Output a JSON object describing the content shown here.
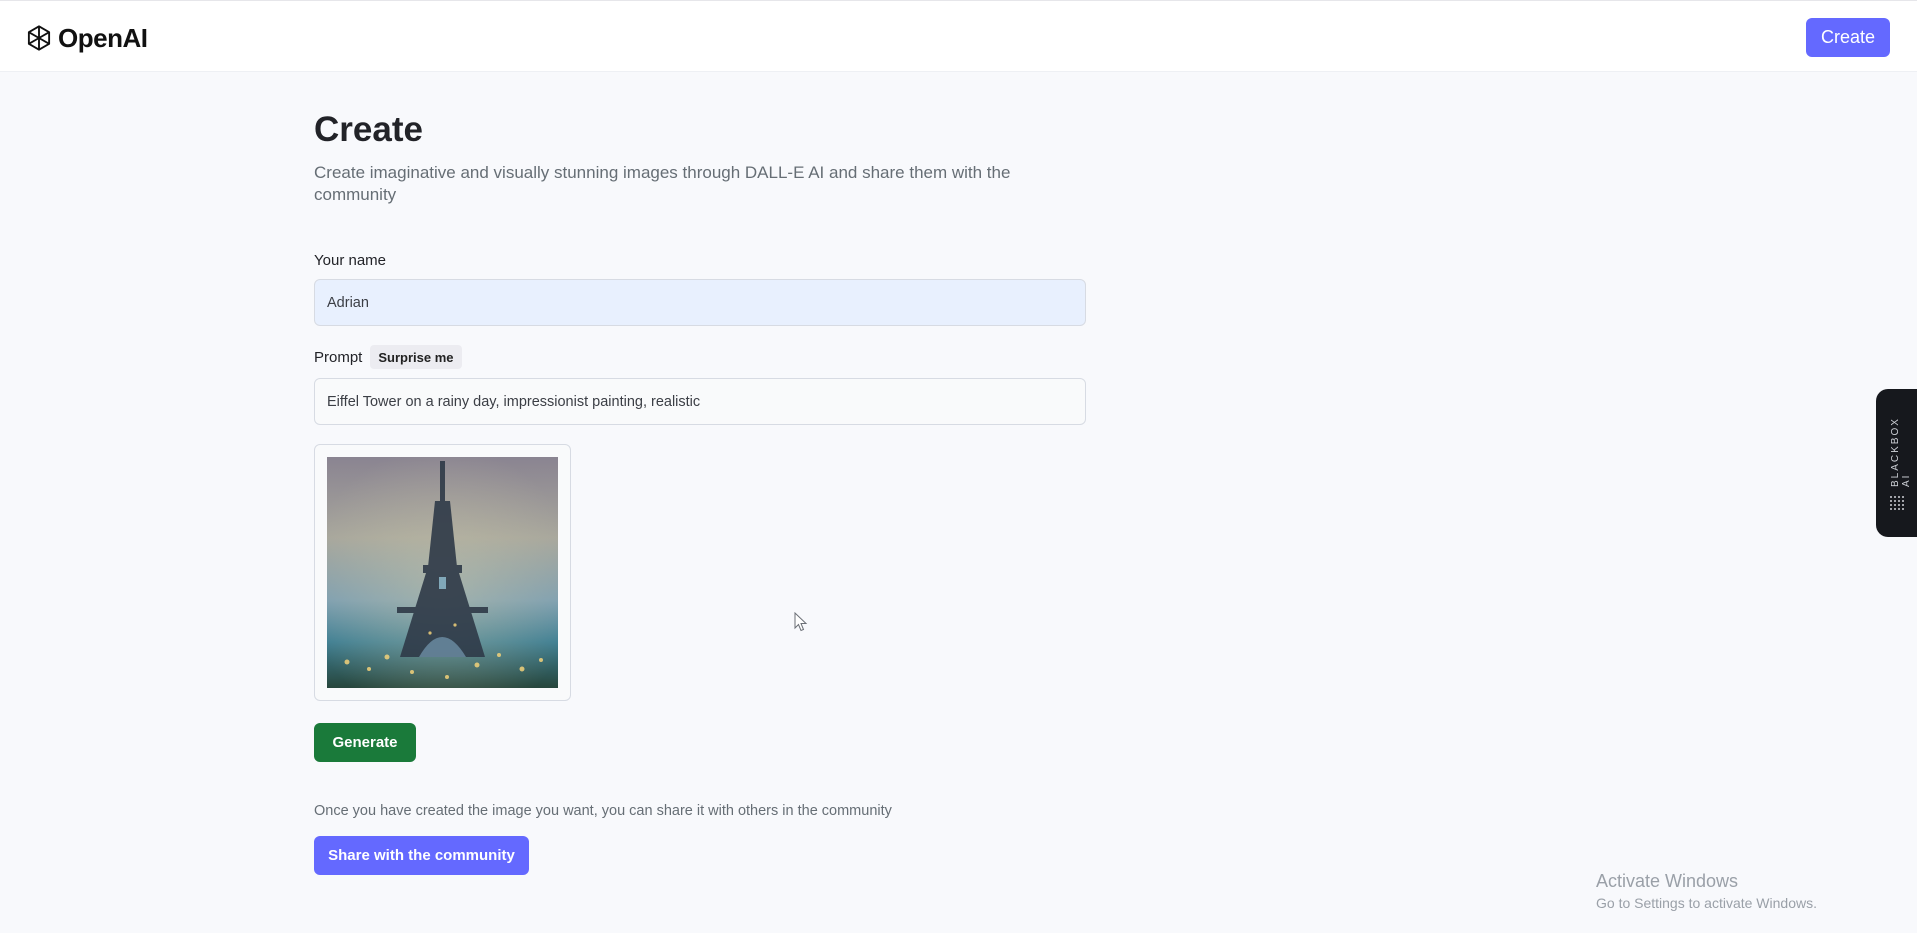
{
  "header": {
    "logo_text": "OpenAI",
    "create_button": "Create"
  },
  "page": {
    "title": "Create",
    "subtitle": "Create imaginative and visually stunning images through DALL-E AI and share them with the community"
  },
  "form": {
    "name_label": "Your name",
    "name_value": "Adrian",
    "prompt_label": "Prompt",
    "surprise_button": "Surprise me",
    "prompt_value": "Eiffel Tower on a rainy day, impressionist painting, realistic"
  },
  "actions": {
    "generate_button": "Generate",
    "share_text": "Once you have created the image you want, you can share it with others in the community",
    "share_button": "Share with the community"
  },
  "side_widget": {
    "label": "BLACKBOX AI"
  },
  "watermark": {
    "title": "Activate Windows",
    "subtitle": "Go to Settings to activate Windows."
  },
  "colors": {
    "accent": "#6469ff",
    "generate": "#1a7a3a",
    "background": "#f8f9fc",
    "name_input_bg": "#e8f0fe"
  },
  "icons": {
    "logo": "openai-logo-icon",
    "widget": "blackbox-dots-icon",
    "cursor": "mouse-cursor-icon"
  }
}
